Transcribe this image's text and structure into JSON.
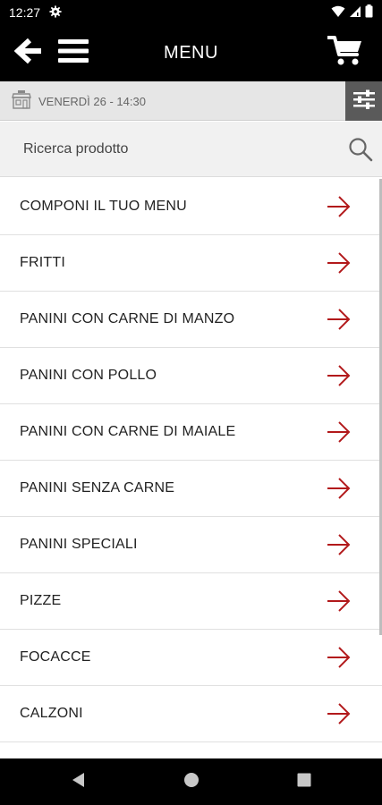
{
  "status_bar": {
    "time": "12:27",
    "icons": [
      "gear-icon",
      "wifi-icon",
      "signal-icon",
      "battery-icon"
    ]
  },
  "header": {
    "title": "MENU",
    "back_icon": "arrow-left-icon",
    "menu_icon": "hamburger-icon",
    "cart_icon": "cart-icon"
  },
  "date_bar": {
    "text": "VENERDÌ 26 - 14:30",
    "icon": "shop-icon",
    "filter_icon": "sliders-icon"
  },
  "search": {
    "placeholder": "Ricerca prodotto",
    "value": "",
    "icon": "search-icon"
  },
  "colors": {
    "accent_red": "#b2191b",
    "header_bg": "#000000",
    "date_bg": "#e6e6e6",
    "filter_bg": "#5a5a5a",
    "search_bg": "#f1f1f1"
  },
  "categories": [
    {
      "label": "COMPONI IL TUO MENU"
    },
    {
      "label": "FRITTI"
    },
    {
      "label": "PANINI CON CARNE DI MANZO"
    },
    {
      "label": "PANINI CON POLLO"
    },
    {
      "label": "PANINI CON CARNE DI MAIALE"
    },
    {
      "label": "PANINI SENZA CARNE"
    },
    {
      "label": "PANINI SPECIALI"
    },
    {
      "label": "PIZZE"
    },
    {
      "label": "FOCACCE"
    },
    {
      "label": "CALZONI"
    },
    {
      "label": ""
    }
  ],
  "nav_bar": {
    "buttons": [
      "back-triangle-icon",
      "home-circle-icon",
      "recents-square-icon"
    ]
  }
}
